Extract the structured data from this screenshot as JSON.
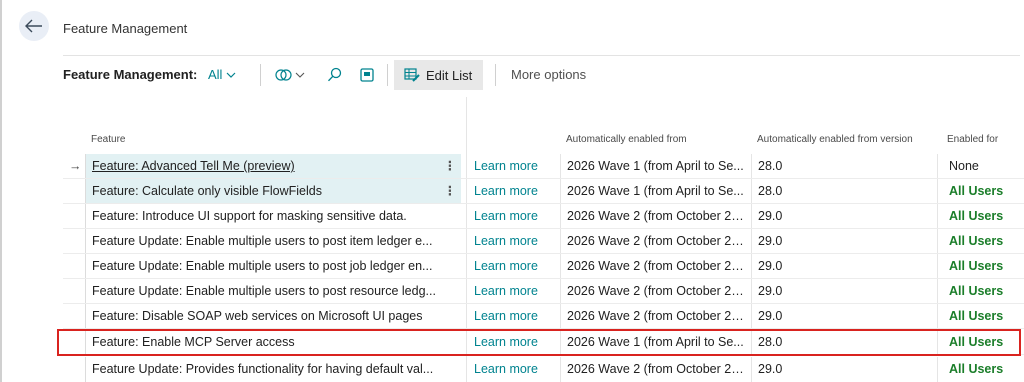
{
  "page": {
    "title": "Feature Management",
    "back_icon": "back-arrow-icon"
  },
  "actionbar": {
    "caption": "Feature Management:",
    "filter_value": "All",
    "edit_list_label": "Edit List",
    "more_options_label": "More options",
    "icons": [
      "view-filter-icon",
      "search-icon",
      "layout-icon",
      "edit-list-icon"
    ]
  },
  "table": {
    "headers": {
      "feature": "Feature",
      "learn": "",
      "auto_from": "Automatically enabled from",
      "auto_version": "Automatically enabled from version",
      "enabled_for": "Enabled for"
    },
    "rows": [
      {
        "feature": "Feature: Advanced Tell Me (preview)",
        "learn": "Learn more",
        "auto_from": "2026 Wave 1 (from April to Se...",
        "version": "28.0",
        "enabled_for": "None"
      },
      {
        "feature": "Feature: Calculate only visible FlowFields",
        "learn": "Learn more",
        "auto_from": "2026 Wave 1 (from April to Se...",
        "version": "28.0",
        "enabled_for": "All Users"
      },
      {
        "feature": "Feature: Introduce UI support for masking sensitive data.",
        "learn": "Learn more",
        "auto_from": "2026 Wave 2 (from October 20...",
        "version": "29.0",
        "enabled_for": "All Users"
      },
      {
        "feature": "Feature Update: Enable multiple users to post item ledger e...",
        "learn": "Learn more",
        "auto_from": "2026 Wave 2 (from October 20...",
        "version": "29.0",
        "enabled_for": "All Users"
      },
      {
        "feature": "Feature Update: Enable multiple users to post job ledger en...",
        "learn": "Learn more",
        "auto_from": "2026 Wave 2 (from October 20...",
        "version": "29.0",
        "enabled_for": "All Users"
      },
      {
        "feature": "Feature Update: Enable multiple users to post resource ledg...",
        "learn": "Learn more",
        "auto_from": "2026 Wave 2 (from October 20...",
        "version": "29.0",
        "enabled_for": "All Users"
      },
      {
        "feature": "Feature: Disable SOAP web services on Microsoft UI pages",
        "learn": "Learn more",
        "auto_from": "2026 Wave 2 (from October 20...",
        "version": "29.0",
        "enabled_for": "All Users"
      },
      {
        "feature": "Feature: Enable MCP Server access",
        "learn": "Learn more",
        "auto_from": "2026 Wave 1 (from April to Se...",
        "version": "28.0",
        "enabled_for": "All Users"
      },
      {
        "feature": "Feature Update: Provides functionality for having default val...",
        "learn": "Learn more",
        "auto_from": "2026 Wave 2 (from October 20...",
        "version": "29.0",
        "enabled_for": "All Users"
      }
    ]
  },
  "colors": {
    "accent": "#00838f",
    "enabled_green": "#1b7e2a",
    "highlight_red": "#d9231f",
    "selection": "#e2f1f3"
  }
}
